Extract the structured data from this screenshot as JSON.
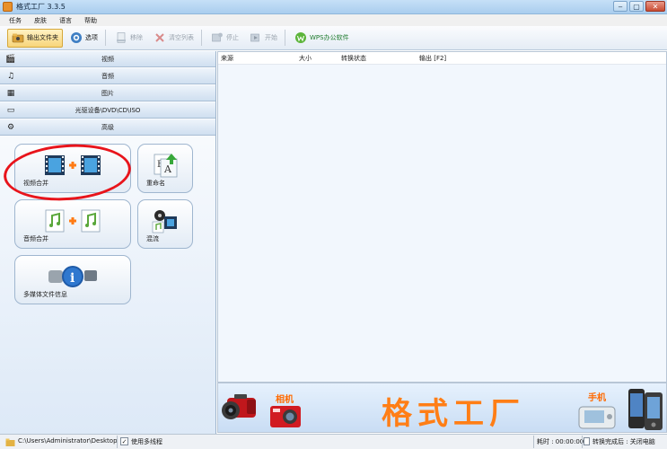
{
  "window": {
    "title": "格式工厂 3.3.5",
    "minimize_glyph": "‒",
    "maximize_glyph": "▢",
    "close_glyph": "✕"
  },
  "menu": {
    "items": [
      "任务",
      "皮肤",
      "语言",
      "帮助"
    ]
  },
  "toolbar": {
    "output_folder": "输出文件夹",
    "options": "选项",
    "remove": "移除",
    "clear_list": "清空列表",
    "stop": "停止",
    "start": "开始",
    "wps": "WPS办公软件"
  },
  "categories": [
    "视频",
    "音频",
    "图片",
    "光驱设备\\DVD\\CD\\ISO",
    "高级"
  ],
  "tiles": {
    "video_merge": "视频合并",
    "rename": "重命名",
    "audio_merge": "音频合并",
    "mix": "混流",
    "media_info": "多媒体文件信息"
  },
  "list_columns": {
    "source": "来源",
    "size": "大小",
    "status": "转换状态",
    "output": "输出 [F2]"
  },
  "banner": {
    "title": "格式工厂",
    "camera_label": "相机",
    "phone_label": "手机"
  },
  "status": {
    "path": "C:\\Users\\Administrator\\Desktop",
    "multithread_check": "✓",
    "multithread": "使用多线程",
    "elapsed": "耗时 : 00:00:00",
    "after_convert": "转换完成后 : 关闭电脑"
  },
  "colors": {
    "banner_title": "#ff7e16",
    "highlight_circle": "#e8141b",
    "active_button": "#f8d57a"
  }
}
